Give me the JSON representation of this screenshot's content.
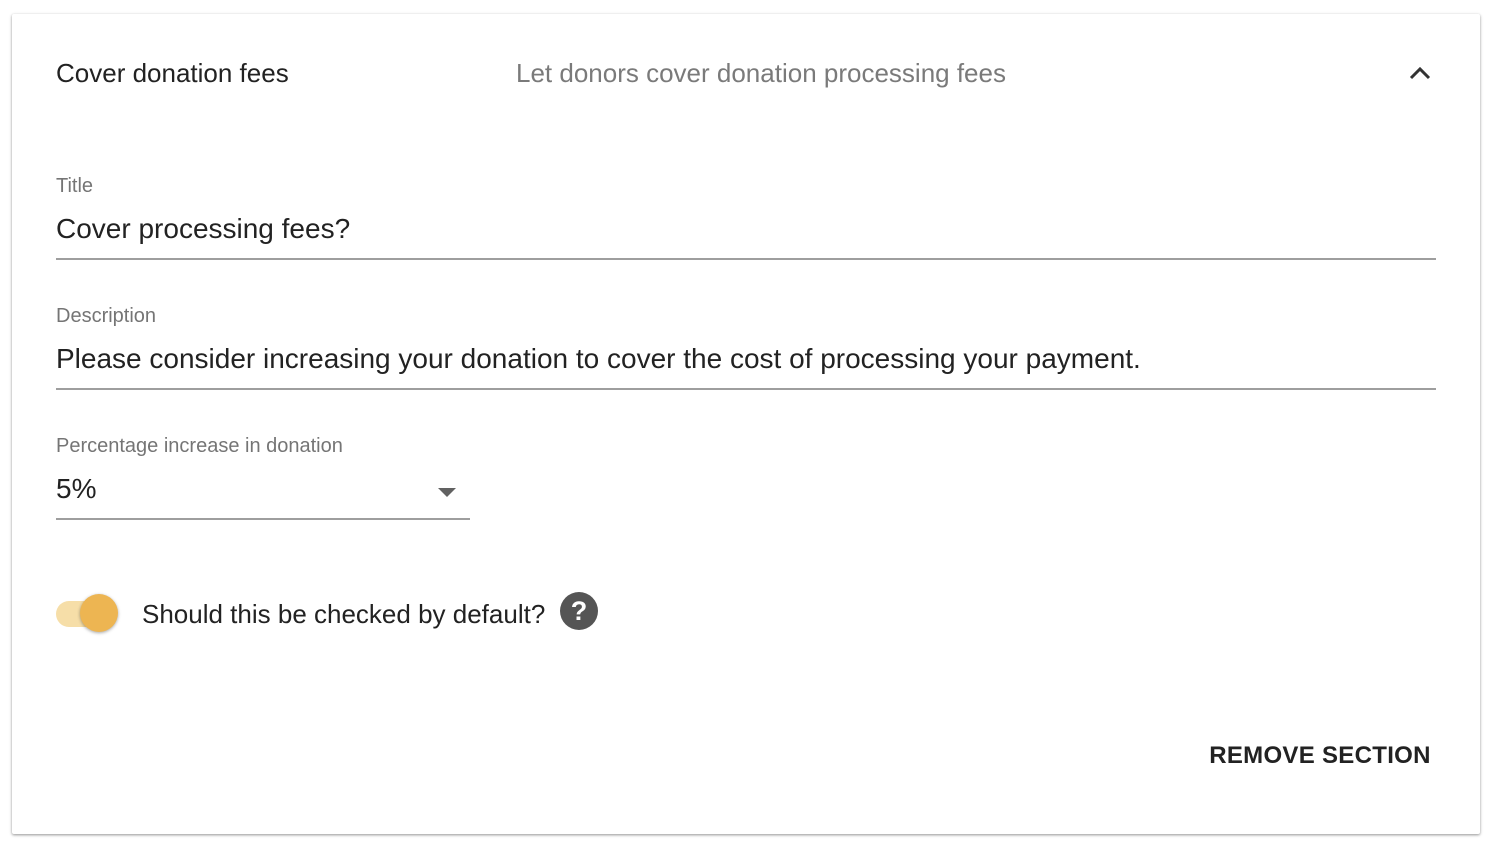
{
  "section": {
    "title": "Cover donation fees",
    "subtitle": "Let donors cover donation processing fees",
    "collapse_icon": "chevron-up-icon"
  },
  "form": {
    "title_field": {
      "label": "Title",
      "value": "Cover processing fees?"
    },
    "description_field": {
      "label": "Description",
      "value": "Please consider increasing your donation to cover the cost of processing your payment."
    },
    "percentage_field": {
      "label": "Percentage increase in donation",
      "selected_value": "5%",
      "dropdown_icon": "caret-down-icon"
    },
    "default_checked_toggle": {
      "label": "Should this be checked by default?",
      "checked": true,
      "help_icon": "help-circle-icon",
      "help_glyph": "?"
    }
  },
  "actions": {
    "remove_label": "REMOVE SECTION"
  },
  "colors": {
    "accent": "#edb552",
    "accent_track": "#f6dea8",
    "text_primary": "#222222",
    "text_secondary": "#7a7a7a",
    "underline": "#9e9e9e",
    "help_icon_bg": "#555555"
  }
}
